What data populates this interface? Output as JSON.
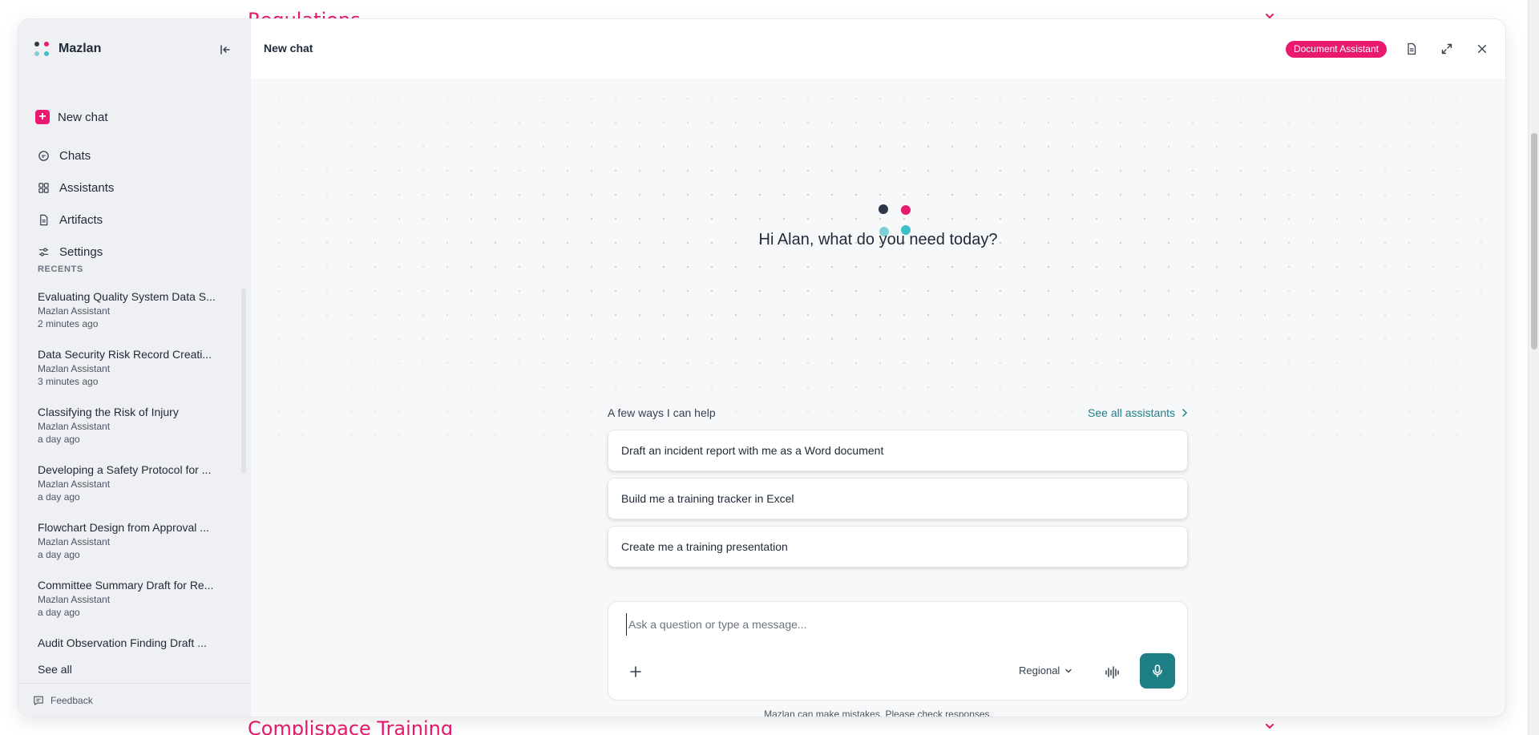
{
  "background": {
    "top_heading": "Regulations",
    "bottom_heading": "Complispace Training"
  },
  "brand": {
    "name": "Mazlan",
    "accent": "#e8196e",
    "teal": "#1f7f86"
  },
  "sidebar": {
    "new_chat": "New chat",
    "nav": [
      {
        "label": "Chats",
        "icon": "chat-icon"
      },
      {
        "label": "Assistants",
        "icon": "grid-icon"
      },
      {
        "label": "Artifacts",
        "icon": "document-icon"
      },
      {
        "label": "Settings",
        "icon": "sliders-icon"
      }
    ],
    "recents_label": "RECENTS",
    "recents": [
      {
        "title": "Evaluating Quality System Data S...",
        "assistant": "Mazlan Assistant",
        "time": "2 minutes ago"
      },
      {
        "title": "Data Security Risk Record Creati...",
        "assistant": "Mazlan Assistant",
        "time": "3 minutes ago"
      },
      {
        "title": "Classifying the Risk of Injury",
        "assistant": "Mazlan Assistant",
        "time": "a day ago"
      },
      {
        "title": "Developing a Safety Protocol for ...",
        "assistant": "Mazlan Assistant",
        "time": "a day ago"
      },
      {
        "title": "Flowchart Design from Approval ...",
        "assistant": "Mazlan Assistant",
        "time": "a day ago"
      },
      {
        "title": "Committee Summary Draft for Re...",
        "assistant": "Mazlan Assistant",
        "time": "a day ago"
      },
      {
        "title": "Audit Observation Finding Draft ..."
      }
    ],
    "see_all": "See all",
    "feedback": "Feedback"
  },
  "header": {
    "title": "New chat",
    "badge": "Document Assistant"
  },
  "main": {
    "greeting": "Hi Alan, what do you need today?",
    "help_label": "A few ways I can help",
    "see_all_assistants": "See all assistants",
    "suggestions": [
      "Draft an incident report with me as a Word document",
      "Build me a training tracker in Excel",
      "Create me a training presentation"
    ],
    "composer": {
      "placeholder": "Ask a question or type a message...",
      "value": "",
      "region": "Regional"
    },
    "disclaimer": "Mazlan can make mistakes. Please check responses."
  }
}
